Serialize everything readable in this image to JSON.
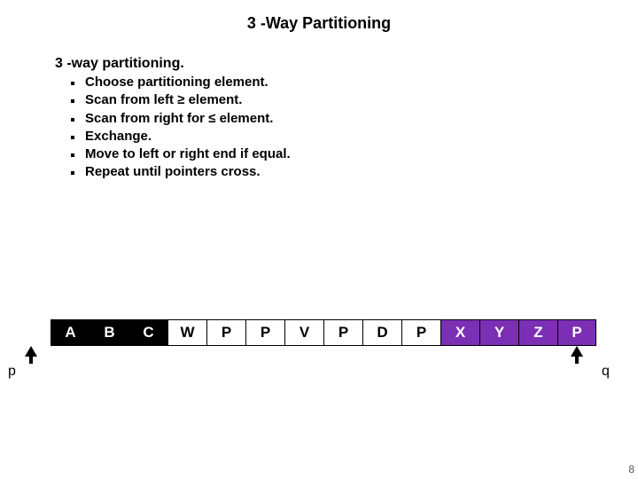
{
  "title": "3 -Way Partitioning",
  "heading": "3 -way partitioning.",
  "bullets": [
    "Choose partitioning element.",
    "Scan from left ≥ element.",
    "Scan from right for ≤  element.",
    "Exchange.",
    "Move to left or right end if equal.",
    "Repeat until pointers cross."
  ],
  "cells": [
    {
      "v": "A",
      "c": "dark"
    },
    {
      "v": "B",
      "c": "dark"
    },
    {
      "v": "C",
      "c": "dark"
    },
    {
      "v": "W",
      "c": "light"
    },
    {
      "v": "P",
      "c": "light"
    },
    {
      "v": "P",
      "c": "light"
    },
    {
      "v": "V",
      "c": "light"
    },
    {
      "v": "P",
      "c": "light"
    },
    {
      "v": "D",
      "c": "light"
    },
    {
      "v": "P",
      "c": "light"
    },
    {
      "v": "X",
      "c": "purple"
    },
    {
      "v": "Y",
      "c": "purple"
    },
    {
      "v": "Z",
      "c": "purple"
    },
    {
      "v": "P",
      "c": "purple"
    }
  ],
  "pointers": {
    "p_label": "p",
    "q_label": "q"
  },
  "slide_number": "8"
}
